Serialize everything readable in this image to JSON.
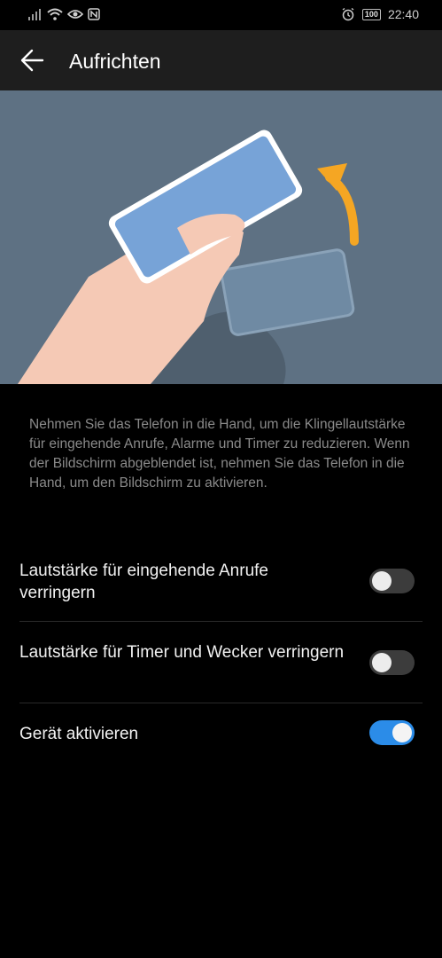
{
  "status_bar": {
    "time": "22:40",
    "battery": "100",
    "icons": [
      "signal-icon",
      "wifi-icon",
      "eye-icon",
      "nfc-icon",
      "alarm-icon",
      "battery-icon"
    ]
  },
  "app_bar": {
    "title": "Aufrichten",
    "back_icon": "arrow-left-icon"
  },
  "description": "Nehmen Sie das Telefon in die Hand, um die Klingellautstärke für eingehende Anrufe, Alarme und Timer zu reduzieren. Wenn der Bildschirm abgeblendet ist, nehmen Sie das Telefon in die Hand, um den Bildschirm zu aktivieren.",
  "settings": [
    {
      "label": "Lautstärke für eingehende Anrufe verringern",
      "enabled": false
    },
    {
      "label": "Lautstärke für Timer und Wecker verringern",
      "enabled": false
    },
    {
      "label": "Gerät aktivieren",
      "enabled": true
    }
  ],
  "colors": {
    "accent": "#2b8ce8",
    "illustration_bg": "#5e7183",
    "arrow": "#f5a623",
    "app_bar_bg": "#1e1e1e"
  }
}
